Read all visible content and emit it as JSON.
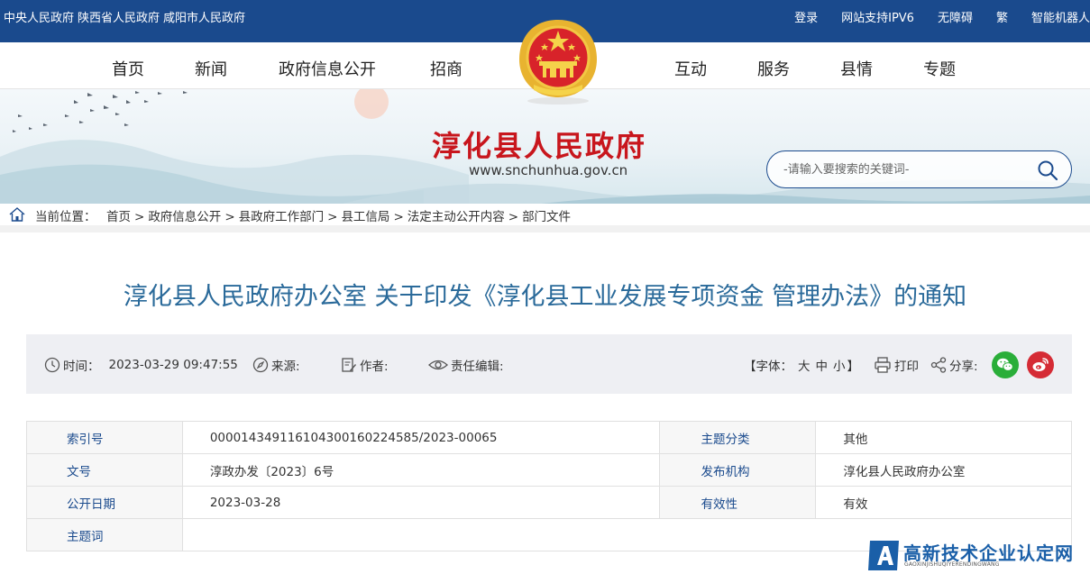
{
  "topbar": {
    "left_links": [
      "中央人民政府",
      "陕西省人民政府",
      "咸阳市人民政府"
    ],
    "right_links": [
      "登录",
      "网站支持IPV6",
      "无障碍",
      "繁",
      "智能机器人"
    ]
  },
  "nav": {
    "items": [
      "首页",
      "新闻",
      "政府信息公开",
      "招商",
      "互动",
      "服务",
      "县情",
      "专题"
    ]
  },
  "banner": {
    "site_name": "淳化县人民政府",
    "site_url": "www.snchunhua.gov.cn",
    "search_placeholder": "-请输入要搜索的关键词-"
  },
  "breadcrumb": {
    "label": "当前位置：",
    "items": [
      "首页",
      "政府信息公开",
      "县政府工作部门",
      "县工信局",
      "法定主动公开内容",
      "部门文件"
    ],
    "separator": ">"
  },
  "article": {
    "title": "淳化县人民政府办公室 关于印发《淳化县工业发展专项资金 管理办法》的通知"
  },
  "meta": {
    "time_label": "时间：",
    "time_value": "2023-03-29 09:47:55",
    "source_label": "来源:",
    "author_label": "作者:",
    "editor_label": "责任编辑:",
    "font_label": "【字体：",
    "font_large": "大",
    "font_medium": "中",
    "font_small": "小",
    "font_close": "】",
    "print_label": "打印",
    "share_label": "分享:"
  },
  "info_table": {
    "rows": [
      {
        "k1": "索引号",
        "v1": "000014349116104300160224585/2023-00065",
        "k2": "主题分类",
        "v2": "其他"
      },
      {
        "k1": "文号",
        "v1": "淳政办发〔2023〕6号",
        "k2": "发布机构",
        "v2": "淳化县人民政府办公室"
      },
      {
        "k1": "公开日期",
        "v1": "2023-03-28",
        "k2": "有效性",
        "v2": "有效"
      }
    ],
    "last_row_key": "主题词",
    "last_row_value": ""
  },
  "watermark": {
    "text": "高新技术企业认定网",
    "sub": "GAOXINJISHUQIYERENDINGWANG"
  },
  "colors": {
    "topbar": "#1a4a8d",
    "site_name": "#c8161d",
    "title": "#2a6a9a",
    "wechat": "#2aae39",
    "weibo": "#d52b35"
  }
}
